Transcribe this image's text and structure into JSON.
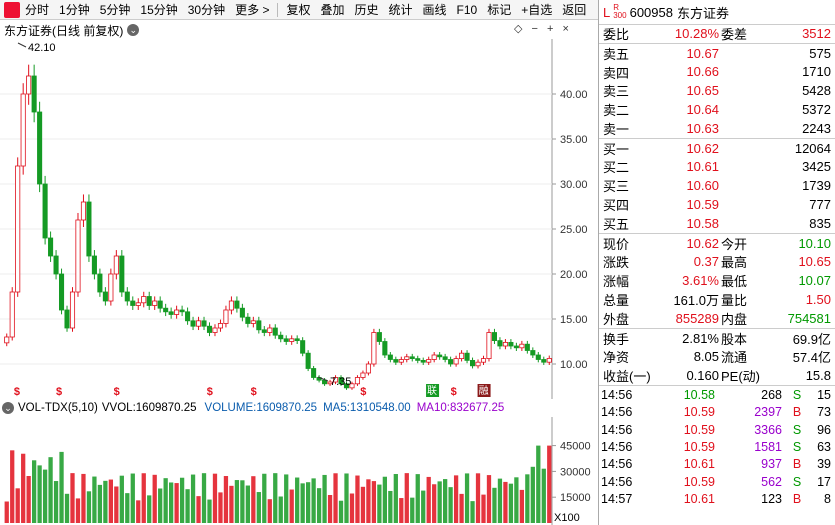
{
  "toolbar": {
    "items": [
      "分时",
      "1分钟",
      "5分钟",
      "15分钟",
      "30分钟",
      "更多 >",
      "复权",
      "叠加",
      "历史",
      "统计",
      "画线",
      "F10",
      "标记",
      "+自选",
      "返回"
    ]
  },
  "chart": {
    "title": "东方证券(日线 前复权)",
    "high_label": "42.10",
    "low_label": "7.35",
    "y_ticks": [
      "40.00",
      "35.00",
      "30.00",
      "25.00",
      "20.00",
      "15.00",
      "10.00"
    ],
    "markers": [
      {
        "t": "$",
        "type": "dividend",
        "x": 0.018
      },
      {
        "t": "$",
        "type": "dividend",
        "x": 0.095
      },
      {
        "t": "$",
        "type": "dividend",
        "x": 0.2
      },
      {
        "t": "$",
        "type": "dividend",
        "x": 0.37
      },
      {
        "t": "$",
        "type": "dividend",
        "x": 0.45
      },
      {
        "t": "$",
        "type": "dividend",
        "x": 0.65
      },
      {
        "t": "联",
        "type": "green",
        "x": 0.772
      },
      {
        "t": "$",
        "type": "dividend",
        "x": 0.815
      },
      {
        "t": "融",
        "type": "red",
        "x": 0.866
      }
    ]
  },
  "chart_data": {
    "type": "candlestick",
    "title": "东方证券(日线 前复权)",
    "ylim": [
      7,
      45
    ],
    "y_ticks": [
      10,
      15,
      20,
      25,
      30,
      35,
      40
    ],
    "series_close": [
      13,
      18,
      32,
      40,
      42,
      38,
      30,
      24,
      22,
      20,
      16,
      14,
      18,
      26,
      28,
      22,
      20,
      18,
      17,
      20,
      22,
      18,
      17,
      16.5,
      16.8,
      17.5,
      16.5,
      17,
      16.2,
      15.8,
      15.5,
      16,
      15.8,
      14.8,
      14.2,
      14.8,
      14.2,
      13.5,
      14,
      14.5,
      16,
      17,
      16.2,
      15.2,
      14.5,
      14.8,
      13.8,
      13.5,
      14,
      13.2,
      12.8,
      12.5,
      12.8,
      12.6,
      11.2,
      9.5,
      8.5,
      8.2,
      7.8,
      8,
      8.5,
      7.8,
      7.35,
      7.8,
      8.5,
      9,
      10,
      13.5,
      12.5,
      11,
      10.5,
      10.2,
      10.5,
      10.8,
      10.6,
      10.4,
      10.2,
      10.5,
      11,
      10.8,
      10.5,
      10,
      10.6,
      11.2,
      10.4,
      9.8,
      10.2,
      10.6,
      13.5,
      12.6,
      12,
      12.4,
      12,
      11.8,
      12.2,
      11.5,
      11,
      10.5,
      10.2,
      10.62
    ],
    "volume": {
      "label": "VOL-TDX(5,10)",
      "vvol": "1609870.25",
      "volume": "1609870.25",
      "ma5": "1310548.00",
      "ma10": "832677.25",
      "y_ticks": [
        15000,
        30000,
        45000
      ],
      "multiplier": "X100"
    }
  },
  "quote": {
    "code": "600958",
    "name": "东方证券",
    "header_L": "L",
    "header_R": "R",
    "header_300": "300",
    "weibi_label": "委比",
    "weibi": "10.28%",
    "weicha_label": "委差",
    "weicha": "3512",
    "sells": [
      {
        "lbl": "卖五",
        "price": "10.67",
        "vol": "575"
      },
      {
        "lbl": "卖四",
        "price": "10.66",
        "vol": "1710"
      },
      {
        "lbl": "卖三",
        "price": "10.65",
        "vol": "5428"
      },
      {
        "lbl": "卖二",
        "price": "10.64",
        "vol": "5372"
      },
      {
        "lbl": "卖一",
        "price": "10.63",
        "vol": "2243"
      }
    ],
    "buys": [
      {
        "lbl": "买一",
        "price": "10.62",
        "vol": "12064"
      },
      {
        "lbl": "买二",
        "price": "10.61",
        "vol": "3425"
      },
      {
        "lbl": "买三",
        "price": "10.60",
        "vol": "1739"
      },
      {
        "lbl": "买四",
        "price": "10.59",
        "vol": "777"
      },
      {
        "lbl": "买五",
        "price": "10.58",
        "vol": "835"
      }
    ],
    "stats": [
      {
        "l1": "现价",
        "v1": "10.62",
        "c1": "red",
        "l2": "今开",
        "v2": "10.10",
        "c2": "green"
      },
      {
        "l1": "涨跌",
        "v1": "0.37",
        "c1": "red",
        "l2": "最高",
        "v2": "10.65",
        "c2": "red"
      },
      {
        "l1": "涨幅",
        "v1": "3.61%",
        "c1": "red",
        "l2": "最低",
        "v2": "10.07",
        "c2": "green"
      },
      {
        "l1": "总量",
        "v1": "161.0万",
        "c1": "",
        "l2": "量比",
        "v2": "1.50",
        "c2": "red"
      },
      {
        "l1": "外盘",
        "v1": "855289",
        "c1": "red",
        "l2": "内盘",
        "v2": "754581",
        "c2": "green"
      }
    ],
    "fund": [
      {
        "l1": "换手",
        "v1": "2.81%",
        "l2": "股本",
        "v2": "69.9亿"
      },
      {
        "l1": "净资",
        "v1": "8.05",
        "l2": "流通",
        "v2": "57.4亿"
      },
      {
        "l1": "收益(一)",
        "v1": "0.160",
        "l2": "PE(动)",
        "v2": "15.8"
      }
    ],
    "ticks": [
      {
        "t": "14:56",
        "p": "10.58",
        "v": "268",
        "bs": "S",
        "c": "15",
        "pc": "green",
        "vc": ""
      },
      {
        "t": "14:56",
        "p": "10.59",
        "v": "2397",
        "bs": "B",
        "c": "73",
        "pc": "red",
        "vc": "purple"
      },
      {
        "t": "14:56",
        "p": "10.59",
        "v": "3366",
        "bs": "S",
        "c": "96",
        "pc": "red",
        "vc": "purple"
      },
      {
        "t": "14:56",
        "p": "10.59",
        "v": "1581",
        "bs": "S",
        "c": "63",
        "pc": "red",
        "vc": "purple"
      },
      {
        "t": "14:56",
        "p": "10.61",
        "v": "937",
        "bs": "B",
        "c": "39",
        "pc": "red",
        "vc": "purple"
      },
      {
        "t": "14:56",
        "p": "10.59",
        "v": "562",
        "bs": "S",
        "c": "17",
        "pc": "red",
        "vc": "purple"
      },
      {
        "t": "14:57",
        "p": "10.61",
        "v": "123",
        "bs": "B",
        "c": "8",
        "pc": "red",
        "vc": ""
      }
    ]
  }
}
